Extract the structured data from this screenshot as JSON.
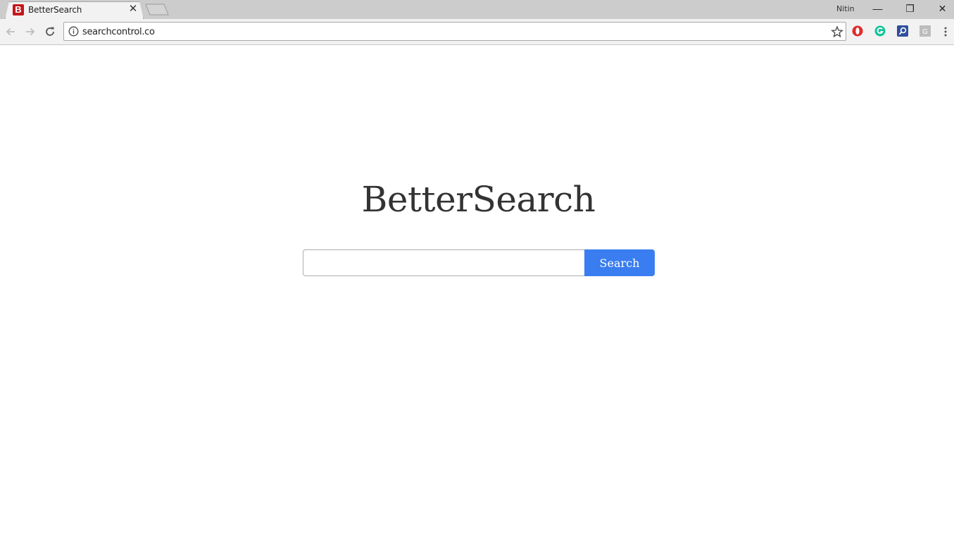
{
  "browser": {
    "tab": {
      "title": "BetterSearch",
      "favicon_letter": "B",
      "close": "✕"
    },
    "profile_name": "Nitin",
    "window_controls": {
      "minimize": "—",
      "maximize": "❐",
      "close": "✕"
    },
    "omnibox": {
      "url": "searchcontrol.co"
    },
    "extensions": [
      "opera-icon",
      "grammarly-icon",
      "search-extension-icon",
      "google-extension-icon"
    ]
  },
  "page": {
    "brand_title": "BetterSearch",
    "search": {
      "value": "",
      "placeholder": "",
      "button_label": "Search"
    }
  },
  "colors": {
    "accent": "#3a7df0",
    "favicon": "#c4161c",
    "title_text": "#333333"
  }
}
